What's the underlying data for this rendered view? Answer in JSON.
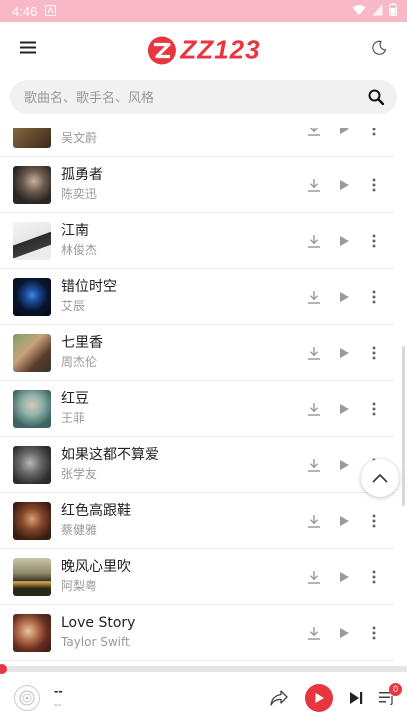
{
  "status_bar": {
    "time": "4:46"
  },
  "header": {
    "logo_text": "ZZ123",
    "brand_color": "#e8353f"
  },
  "search": {
    "placeholder": "歌曲名、歌手名、风格",
    "value": ""
  },
  "partial_row": {
    "artist": "吴文蔚"
  },
  "songs": [
    {
      "title": "孤勇者",
      "artist": "陈奕迅"
    },
    {
      "title": "江南",
      "artist": "林俊杰"
    },
    {
      "title": "错位时空",
      "artist": "艾辰"
    },
    {
      "title": "七里香",
      "artist": "周杰伦"
    },
    {
      "title": "红豆",
      "artist": "王菲"
    },
    {
      "title": "如果这都不算爱",
      "artist": "张学友"
    },
    {
      "title": "红色高跟鞋",
      "artist": "蔡健雅"
    },
    {
      "title": "晚风心里吹",
      "artist": "阿梨粤"
    },
    {
      "title": "Love Story",
      "artist": "Taylor Swift"
    }
  ],
  "player": {
    "title": "--",
    "artist": "--",
    "queue_count": "0",
    "progress": 0
  }
}
